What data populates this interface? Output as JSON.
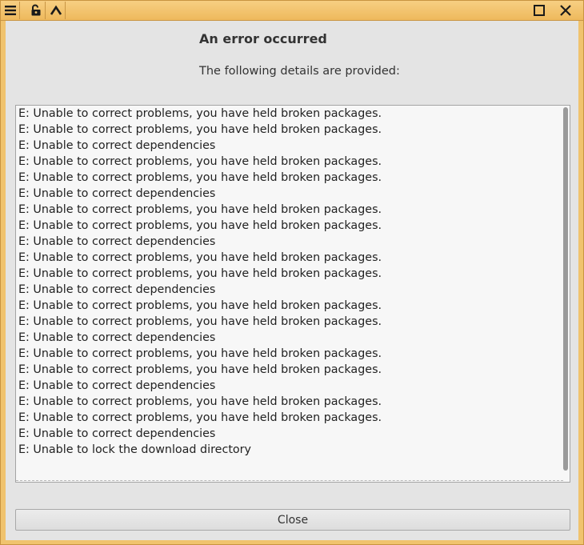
{
  "window": {
    "accent_color": "#f0c36e",
    "titlebar_icons": [
      "menu-icon",
      "unlock-icon",
      "keep-above-icon",
      "maximize-icon",
      "close-icon"
    ]
  },
  "dialog": {
    "heading": "An error occurred",
    "subheading": "The following details are provided:",
    "log_lines": [
      "E: Unable to correct problems, you have held broken packages.",
      "E: Unable to correct problems, you have held broken packages.",
      "E: Unable to correct dependencies",
      "E: Unable to correct problems, you have held broken packages.",
      "E: Unable to correct problems, you have held broken packages.",
      "E: Unable to correct dependencies",
      "E: Unable to correct problems, you have held broken packages.",
      "E: Unable to correct problems, you have held broken packages.",
      "E: Unable to correct dependencies",
      "E: Unable to correct problems, you have held broken packages.",
      "E: Unable to correct problems, you have held broken packages.",
      "E: Unable to correct dependencies",
      "E: Unable to correct problems, you have held broken packages.",
      "E: Unable to correct problems, you have held broken packages.",
      "E: Unable to correct dependencies",
      "E: Unable to correct problems, you have held broken packages.",
      "E: Unable to correct problems, you have held broken packages.",
      "E: Unable to correct dependencies",
      "E: Unable to correct problems, you have held broken packages.",
      "E: Unable to correct problems, you have held broken packages.",
      "E: Unable to correct dependencies",
      "E: Unable to lock the download directory"
    ],
    "close_label": "Close"
  }
}
